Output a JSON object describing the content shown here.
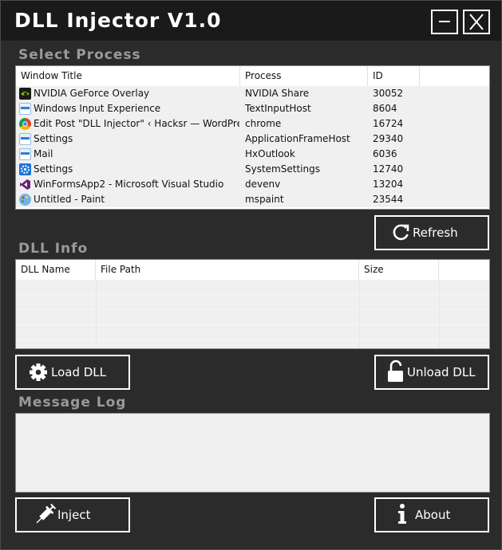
{
  "app": {
    "title": "DLL Injector V1.0",
    "minimize_glyph": "minimize-icon",
    "close_glyph": "close-icon"
  },
  "process_section": {
    "label": "Select Process",
    "columns": [
      "Window Title",
      "Process",
      "ID"
    ],
    "rows": [
      {
        "icon": "nvidia-icon",
        "title": "NVIDIA GeForce Overlay",
        "process": "NVIDIA Share",
        "id": "30052"
      },
      {
        "icon": "window-app-icon",
        "title": "Windows Input Experience",
        "process": "TextInputHost",
        "id": "8604"
      },
      {
        "icon": "chrome-icon",
        "title": "Edit Post \"DLL Injector\" ‹ Hacksr — WordPress ...",
        "process": "chrome",
        "id": "16724"
      },
      {
        "icon": "window-app-icon",
        "title": "Settings",
        "process": "ApplicationFrameHost",
        "id": "29340"
      },
      {
        "icon": "window-app-icon",
        "title": "Mail",
        "process": "HxOutlook",
        "id": "6036"
      },
      {
        "icon": "settings-gear-icon",
        "title": "Settings",
        "process": "SystemSettings",
        "id": "12740"
      },
      {
        "icon": "visual-studio-icon",
        "title": "WinFormsApp2 - Microsoft Visual Studio",
        "process": "devenv",
        "id": "13204"
      },
      {
        "icon": "paint-icon",
        "title": "Untitled - Paint",
        "process": "mspaint",
        "id": "23544"
      }
    ]
  },
  "refresh_button": {
    "label": "Refresh",
    "icon": "refresh-icon"
  },
  "dll_section": {
    "label": "DLL Info",
    "columns": [
      "DLL Name",
      "File Path",
      "Size"
    ],
    "rows": []
  },
  "load_button": {
    "label": "Load DLL",
    "icon": "gear-icon"
  },
  "unload_button": {
    "label": "Unload DLL",
    "icon": "unlock-icon"
  },
  "log_section": {
    "label": "Message Log",
    "content": ""
  },
  "inject_button": {
    "label": "Inject",
    "icon": "syringe-icon"
  },
  "about_button": {
    "label": "About",
    "icon": "info-icon"
  },
  "colors": {
    "window_bg": "#2b2b2b",
    "titlebar_bg": "#1a1a1a",
    "section_label": "#9a9a9a",
    "list_bg": "#f0f0f0",
    "button_border": "#ffffff"
  }
}
